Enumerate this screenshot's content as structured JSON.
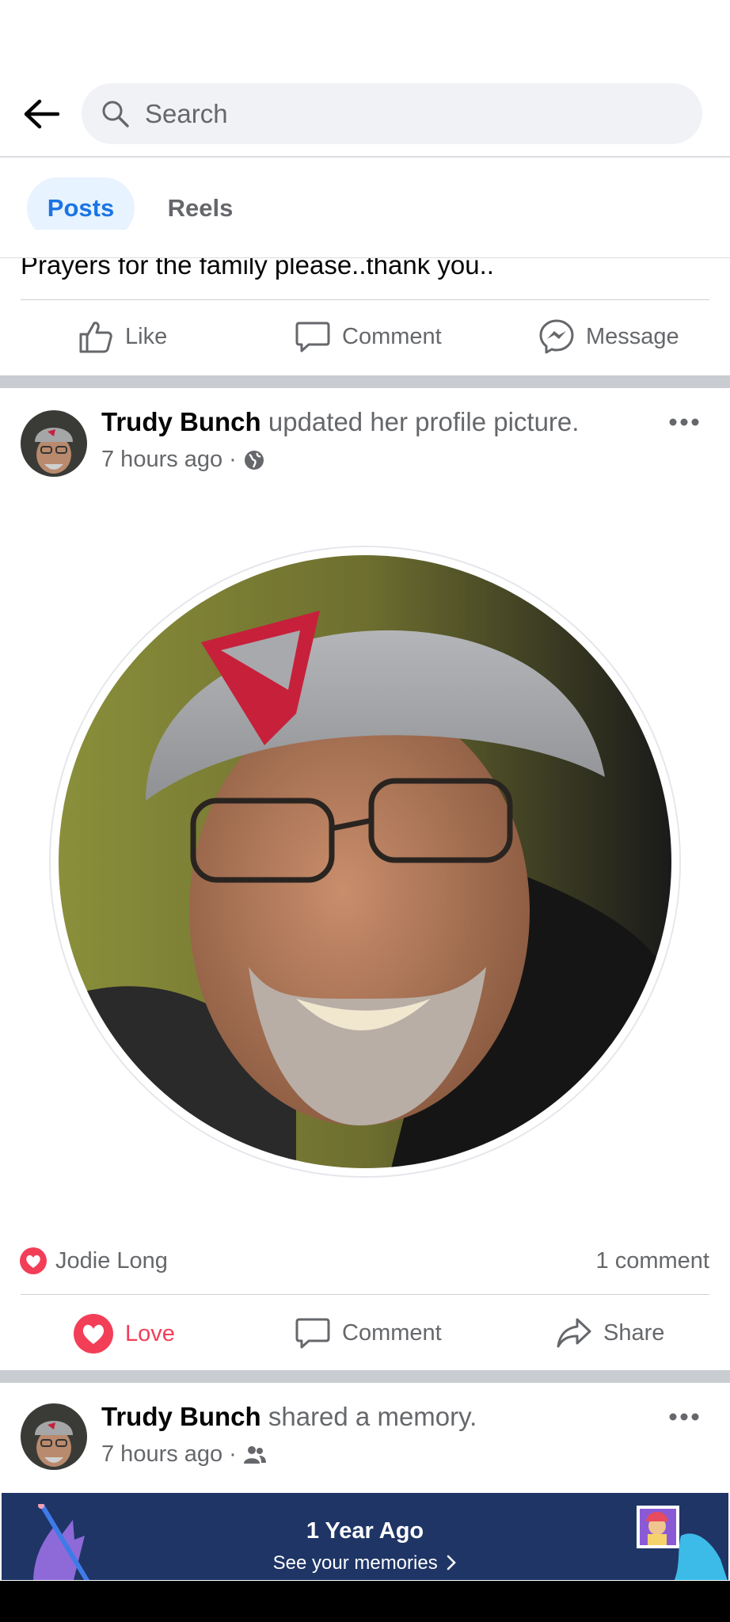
{
  "header": {
    "search_placeholder": "Search"
  },
  "tabs": [
    {
      "label": "Posts",
      "active": true
    },
    {
      "label": "Reels",
      "active": false
    }
  ],
  "previous_post": {
    "text": "Prayers for the family please..thank you..",
    "actions": {
      "like": "Like",
      "comment": "Comment",
      "message": "Message"
    }
  },
  "post1": {
    "author": "Trudy Bunch",
    "action_text": "updated her profile picture.",
    "time": "7 hours ago",
    "audience_icon": "globe-icon",
    "reactions": "Jodie Long",
    "comments": "1 comment",
    "actions": {
      "love": "Love",
      "comment": "Comment",
      "share": "Share"
    }
  },
  "post2": {
    "author": "Trudy Bunch",
    "action_text": "shared a memory.",
    "time": "7 hours ago",
    "audience_icon": "friends-icon",
    "memory_title": "1 Year Ago",
    "memory_link": "See your memories"
  },
  "colors": {
    "accent": "#1b74e4",
    "love": "#f33e58",
    "memory_banner": "#1f3566"
  }
}
